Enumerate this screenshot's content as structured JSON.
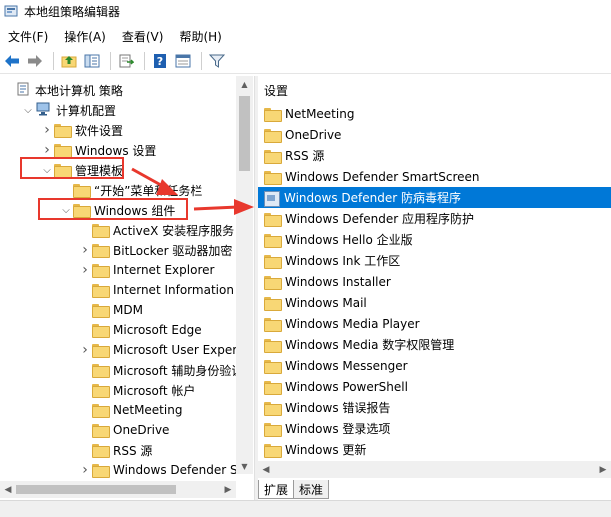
{
  "window": {
    "title": "本地组策略编辑器"
  },
  "menu": [
    {
      "label": "文件(F)"
    },
    {
      "label": "操作(A)"
    },
    {
      "label": "查看(V)"
    },
    {
      "label": "帮助(H)"
    }
  ],
  "toolbar": {
    "buttons": [
      "back-arrow-icon",
      "forward-arrow-icon",
      "up-folder-icon",
      "show-hide-tree-icon",
      "export-list-icon",
      "help-icon",
      "properties-icon",
      "filter-icon"
    ]
  },
  "tree": {
    "items": [
      {
        "label": "本地计算机 策略",
        "level": 0,
        "expander": "",
        "icon": "computer-policy"
      },
      {
        "label": "计算机配置",
        "level": 1,
        "expander": "expanded",
        "icon": "computer"
      },
      {
        "label": "软件设置",
        "level": 2,
        "expander": "collapsed",
        "icon": "folder"
      },
      {
        "label": "Windows 设置",
        "level": 2,
        "expander": "collapsed",
        "icon": "folder"
      },
      {
        "label": "管理模板",
        "level": 2,
        "expander": "expanded",
        "icon": "folder"
      },
      {
        "label": "“开始”菜单和任务栏",
        "level": 3,
        "expander": "",
        "icon": "folder"
      },
      {
        "label": "Windows 组件",
        "level": 3,
        "expander": "expanded",
        "icon": "folder"
      },
      {
        "label": "ActiveX 安装程序服务",
        "level": 4,
        "expander": "",
        "icon": "folder"
      },
      {
        "label": "BitLocker 驱动器加密",
        "level": 4,
        "expander": "collapsed",
        "icon": "folder"
      },
      {
        "label": "Internet Explorer",
        "level": 4,
        "expander": "collapsed",
        "icon": "folder"
      },
      {
        "label": "Internet Information Ser",
        "level": 4,
        "expander": "",
        "icon": "folder"
      },
      {
        "label": "MDM",
        "level": 4,
        "expander": "",
        "icon": "folder"
      },
      {
        "label": "Microsoft Edge",
        "level": 4,
        "expander": "",
        "icon": "folder"
      },
      {
        "label": "Microsoft User Experier",
        "level": 4,
        "expander": "collapsed",
        "icon": "folder"
      },
      {
        "label": "Microsoft 辅助身份验证",
        "level": 4,
        "expander": "",
        "icon": "folder"
      },
      {
        "label": "Microsoft 帐户",
        "level": 4,
        "expander": "",
        "icon": "folder"
      },
      {
        "label": "NetMeeting",
        "level": 4,
        "expander": "",
        "icon": "folder"
      },
      {
        "label": "OneDrive",
        "level": 4,
        "expander": "",
        "icon": "folder"
      },
      {
        "label": "RSS 源",
        "level": 4,
        "expander": "",
        "icon": "folder"
      },
      {
        "label": "Windows Defender Sma",
        "level": 4,
        "expander": "collapsed",
        "icon": "folder"
      }
    ]
  },
  "list": {
    "header": "设置",
    "items": [
      {
        "label": "NetMeeting",
        "icon": "folder",
        "selected": false
      },
      {
        "label": "OneDrive",
        "icon": "folder",
        "selected": false
      },
      {
        "label": "RSS 源",
        "icon": "folder",
        "selected": false
      },
      {
        "label": "Windows Defender SmartScreen",
        "icon": "folder",
        "selected": false
      },
      {
        "label": "Windows Defender 防病毒程序",
        "icon": "policy",
        "selected": true
      },
      {
        "label": "Windows Defender 应用程序防护",
        "icon": "folder",
        "selected": false
      },
      {
        "label": "Windows Hello 企业版",
        "icon": "folder",
        "selected": false
      },
      {
        "label": "Windows Ink 工作区",
        "icon": "folder",
        "selected": false
      },
      {
        "label": "Windows Installer",
        "icon": "folder",
        "selected": false
      },
      {
        "label": "Windows Mail",
        "icon": "folder",
        "selected": false
      },
      {
        "label": "Windows Media Player",
        "icon": "folder",
        "selected": false
      },
      {
        "label": "Windows Media 数字权限管理",
        "icon": "folder",
        "selected": false
      },
      {
        "label": "Windows Messenger",
        "icon": "folder",
        "selected": false
      },
      {
        "label": "Windows PowerShell",
        "icon": "folder",
        "selected": false
      },
      {
        "label": "Windows 错误报告",
        "icon": "folder",
        "selected": false
      },
      {
        "label": "Windows 登录选项",
        "icon": "folder",
        "selected": false
      },
      {
        "label": "Windows 更新",
        "icon": "folder",
        "selected": false
      }
    ]
  },
  "tabs": [
    {
      "label": "扩展",
      "active": true
    },
    {
      "label": "标准",
      "active": false
    }
  ],
  "colors": {
    "selection": "#0078d7",
    "annotation": "#e8382d",
    "folder": "#f8d775"
  }
}
